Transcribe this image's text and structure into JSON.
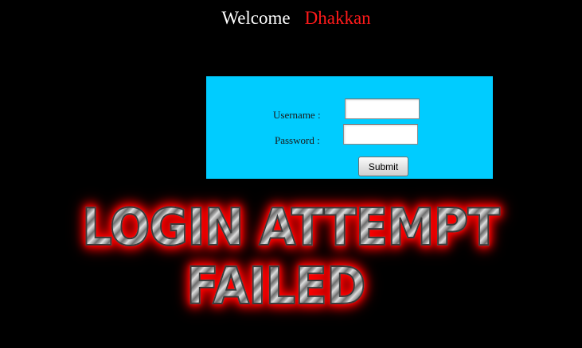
{
  "welcome": {
    "label": "Welcome",
    "username": "Dhakkan"
  },
  "login_form": {
    "username_label": "Username :",
    "password_label": "Password :",
    "username_value": "",
    "password_value": "",
    "submit_label": "Submit",
    "background_color": "#00ccff"
  },
  "status": {
    "line1": "LOGIN ATTEMPT",
    "line2": "FAILED",
    "glow_color": "#ff0000"
  },
  "colors": {
    "page_background": "#000000",
    "welcome_text": "#ffffff",
    "username_text": "#ff1a1a"
  }
}
